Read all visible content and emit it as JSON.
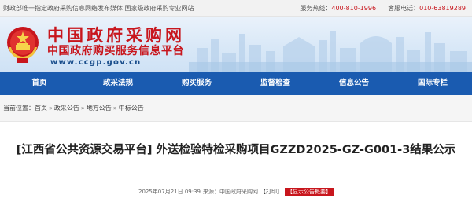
{
  "topbar": {
    "notice": "财政部唯一指定政府采购信息网络发布媒体 国家级政府采购专业网站",
    "service_label": "服务热线：",
    "service_value": "400-810-1996",
    "phone_label": "客服电话：",
    "phone_value": "010-63819289"
  },
  "header": {
    "title": "中国政府采购网",
    "subtitle": "中国政府购买服务信息平台",
    "url": "www.ccgp.gov.cn",
    "brand_color": "#c8161d",
    "emblem_icon": "national-emblem"
  },
  "nav": {
    "color": "#1a5bb0",
    "items": [
      {
        "label": "首页"
      },
      {
        "label": "政采法规"
      },
      {
        "label": "购买服务"
      },
      {
        "label": "监督检查"
      },
      {
        "label": "信息公告"
      },
      {
        "label": "国际专栏"
      }
    ]
  },
  "breadcrumb": {
    "prefix": "当前位置：",
    "items": [
      "首页",
      "政采公告",
      "地方公告",
      "中标公告"
    ],
    "separator": "»"
  },
  "article": {
    "title": "[江西省公共资源交易平台] 外送检验特检采购项目GZZD2025-GZ-G001-3结果公示",
    "date": "2025年07月21日 09:39",
    "source_label": "来源：",
    "source": "中国政府采购网",
    "print_label": "【打印】",
    "overview_label": "【显示公告概要】"
  }
}
